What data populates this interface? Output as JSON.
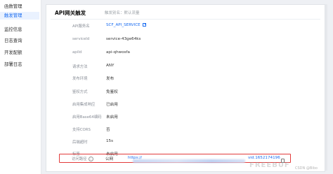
{
  "sidebar": {
    "items": [
      {
        "label": "函数管理",
        "active": false
      },
      {
        "label": "触发管理",
        "active": true
      },
      {
        "label": "监控信息",
        "active": false
      },
      {
        "label": "日志查询",
        "active": false
      },
      {
        "label": "开发配额",
        "active": false
      },
      {
        "label": "部署日志",
        "active": false
      }
    ]
  },
  "panel": {
    "title": "API网关触发",
    "hint": "触发别名：默认流量"
  },
  "rows": [
    {
      "label": "API服务名",
      "value": "SCF_API_SERVICE"
    },
    {
      "label": "serviceId",
      "value": "service-43ge64ks"
    },
    {
      "label": "apiId",
      "value": "api-qhwosfa"
    },
    {
      "label": "请求方法",
      "value": "ANY"
    },
    {
      "label": "发布环境",
      "value": "发布"
    },
    {
      "label": "鉴权方式",
      "value": "免鉴权"
    },
    {
      "label": "启用集成响应",
      "value": "已启用"
    },
    {
      "label": "启用Base64编码",
      "value": "未启用"
    },
    {
      "label": "支持CORS",
      "value": "否"
    },
    {
      "label": "后端超时",
      "value": "15s"
    },
    {
      "label": "标签",
      "value": "未启用"
    }
  ],
  "access_path": {
    "label": "访问路径",
    "network": "公网",
    "url_prefix": "https://",
    "url_suffix": "vid.1652174196"
  },
  "watermarks": {
    "freebuf": "FREEBUF",
    "csdn": "CSDN @Bibo"
  },
  "colors": {
    "accent": "#1a6cf0",
    "highlight": "#e23a3a"
  }
}
